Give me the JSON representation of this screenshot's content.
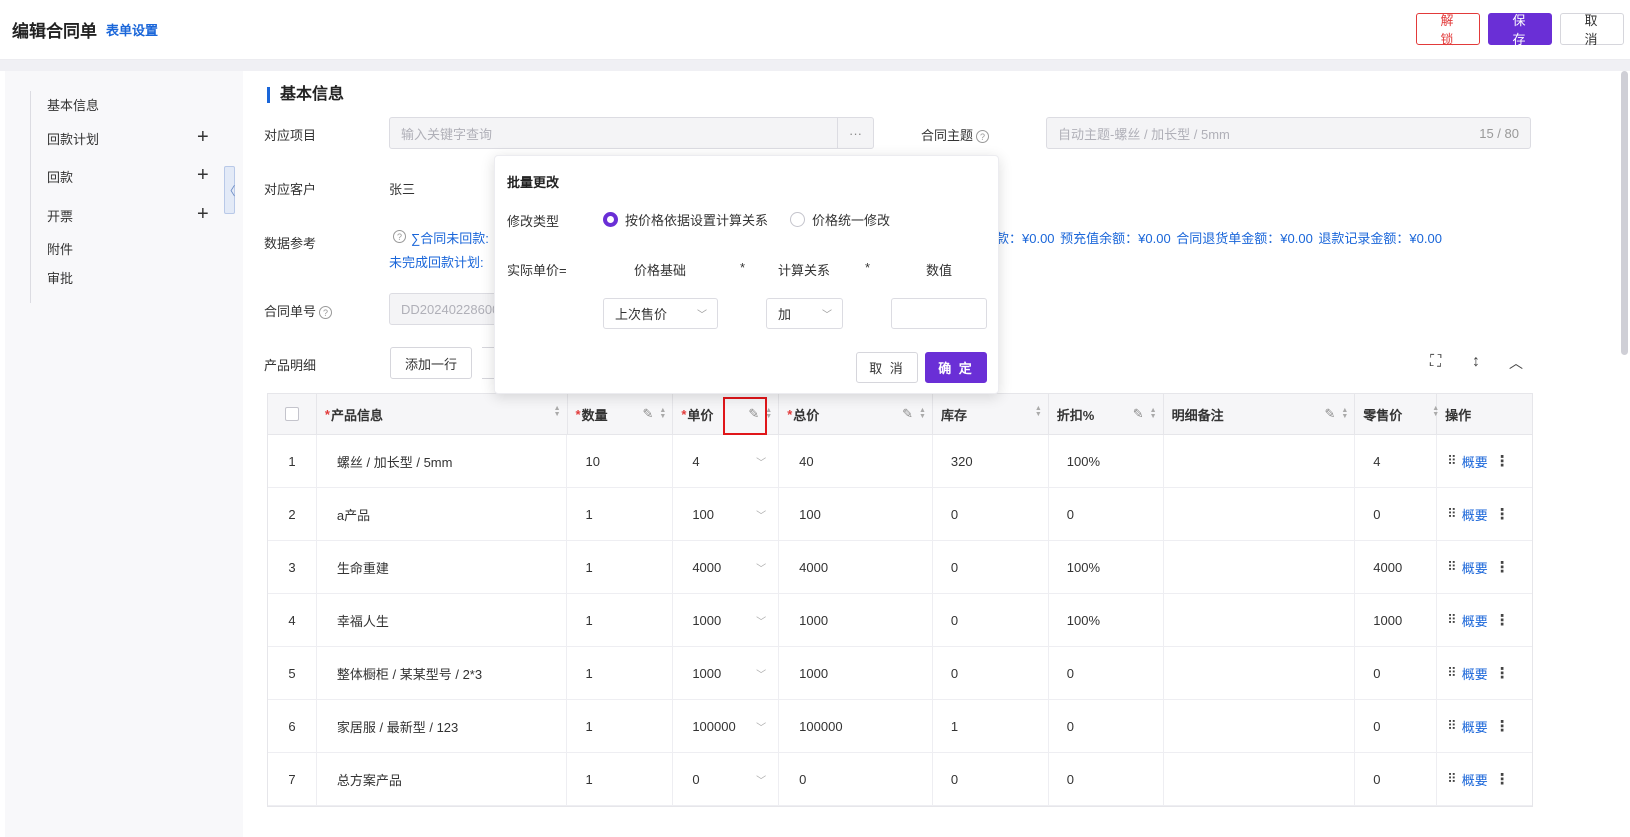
{
  "header": {
    "title": "编辑合同单",
    "form_settings": "表单设置",
    "unlock": "解 锁",
    "save": "保 存",
    "cancel": "取 消"
  },
  "sidebar": {
    "items": [
      {
        "label": "基本信息"
      },
      {
        "label": "回款计划"
      },
      {
        "label": "回款"
      },
      {
        "label": "开票"
      },
      {
        "label": "附件"
      },
      {
        "label": "审批"
      }
    ],
    "collapse_glyph": "〈"
  },
  "basic": {
    "section_title": "基本信息",
    "project_label": "对应项目",
    "project_placeholder": "输入关键字查询",
    "project_more": "···",
    "subject_label": "合同主题",
    "subject_value": "自动主题-螺丝 / 加长型 / 5mm",
    "subject_count": "15 / 80",
    "customer_label": "对应客户",
    "customer_value": "张三",
    "ref_label": "数据参考",
    "ref_line1_left": "∑合同未回款:",
    "ref_line1_right": "款：¥0.00    预充值余额：¥0.00    合同退货单金额：¥0.00    退款记录金额：¥0.00",
    "ref_line2": "未完成回款计划:",
    "number_label": "合同单号",
    "number_value": "DD20240228600"
  },
  "products": {
    "label": "产品明细",
    "add_row": "添加一行"
  },
  "table": {
    "headers": {
      "product": "产品信息",
      "qty": "数量",
      "price": "单价",
      "total": "总价",
      "stock": "库存",
      "discount": "折扣%",
      "remark": "明细备注",
      "retail": "零售价",
      "ops": "操作"
    },
    "summary_label": "概要",
    "rows": [
      {
        "idx": "1",
        "product": "螺丝 / 加长型 / 5mm",
        "qty": "10",
        "price": "4",
        "total": "40",
        "stock": "320",
        "discount": "100%",
        "remark": "",
        "retail": "4"
      },
      {
        "idx": "2",
        "product": "a产品",
        "qty": "1",
        "price": "100",
        "total": "100",
        "stock": "0",
        "discount": "0",
        "remark": "",
        "retail": "0"
      },
      {
        "idx": "3",
        "product": "生命重建",
        "qty": "1",
        "price": "4000",
        "total": "4000",
        "stock": "0",
        "discount": "100%",
        "remark": "",
        "retail": "4000"
      },
      {
        "idx": "4",
        "product": "幸福人生",
        "qty": "1",
        "price": "1000",
        "total": "1000",
        "stock": "0",
        "discount": "100%",
        "remark": "",
        "retail": "1000"
      },
      {
        "idx": "5",
        "product": "整体橱柜 / 某某型号 / 2*3",
        "qty": "1",
        "price": "1000",
        "total": "1000",
        "stock": "0",
        "discount": "0",
        "remark": "",
        "retail": "0"
      },
      {
        "idx": "6",
        "product": "家居服 / 最新型 / 123",
        "qty": "1",
        "price": "100000",
        "total": "100000",
        "stock": "1",
        "discount": "0",
        "remark": "",
        "retail": "0"
      },
      {
        "idx": "7",
        "product": "总方案产品",
        "qty": "1",
        "price": "0",
        "total": "0",
        "stock": "0",
        "discount": "0",
        "remark": "",
        "retail": "0"
      }
    ]
  },
  "popover": {
    "title": "批量更改",
    "type_label": "修改类型",
    "option_formula": "按价格依据设置计算关系",
    "option_uniform": "价格统一修改",
    "formula_label": "实际单价=",
    "col_base": "价格基础",
    "times": "*",
    "col_relation": "计算关系",
    "col_value": "数值",
    "base_value": "上次售价",
    "relation_value": "加",
    "cancel": "取 消",
    "ok": "确 定"
  },
  "colors": {
    "accent": "#6a2fd6",
    "link": "#1a66d9",
    "danger": "#e23a3a",
    "highlight": "#e0161a"
  }
}
